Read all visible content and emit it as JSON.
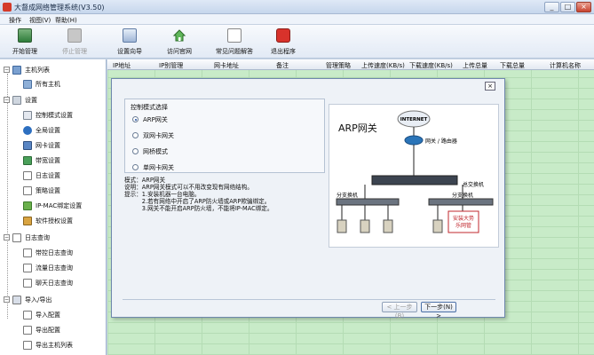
{
  "window": {
    "title": "大督成网络管理系统(V3.50)",
    "minimize": "_",
    "maximize": "□",
    "close": "×"
  },
  "menu": [
    "操作",
    "视图(V)",
    "帮助(H)"
  ],
  "toolbar": [
    {
      "label": "开始管理",
      "icon": "start-manage-icon",
      "disabled": false
    },
    {
      "label": "停止管理",
      "icon": "stop-manage-icon",
      "disabled": true
    },
    {
      "label": "设置向导",
      "icon": "wizard-icon",
      "disabled": false
    },
    {
      "label": "访问官网",
      "icon": "home-icon",
      "disabled": false
    },
    {
      "label": "常见问题解答",
      "icon": "faq-icon",
      "disabled": false
    },
    {
      "label": "退出程序",
      "icon": "power-icon",
      "disabled": false
    }
  ],
  "tree": {
    "groups": [
      {
        "label": "主机列表",
        "items": [
          "所有主机"
        ]
      },
      {
        "label": "设置",
        "items": [
          "控制模式设置",
          "全局设置",
          "网卡设置",
          "带宽设置",
          "日志设置",
          "策略设置",
          "IP-MAC绑定设置",
          "软件授权设置"
        ]
      },
      {
        "label": "日志查询",
        "items": [
          "带控日志查询",
          "流量日志查询",
          "聊天日志查询"
        ]
      },
      {
        "label": "导入/导出",
        "items": [
          "导入配置",
          "导出配置",
          "导出主机列表"
        ]
      }
    ]
  },
  "columns": [
    "IP地址",
    "IP别管理",
    "网卡地址",
    "备注",
    "管理策略",
    "上传速度(KB/s)",
    "下载速度(KB/s)",
    "上传总量",
    "下载总量",
    "计算机名称"
  ],
  "dialog": {
    "close": "×",
    "group_title": "控制模式选择",
    "options": [
      "ARP网关",
      "双网卡网关",
      "网桥模式",
      "单网卡网关"
    ],
    "selected": 0,
    "desc": [
      "模式：ARP网关",
      "说明：ARP网关模式可以不用改变现有网络结构。",
      "提示：1.安装机器一台电脑。",
      "　　　2.若有网络中开启了ARP防火墙或ARP欺骗绑定。",
      "　　　3.网关不能开启ARP防火墙，不能将IP-MAC绑定。"
    ],
    "diagram": {
      "title": "ARP网关",
      "internet": "INTERNET",
      "router": "网关 / 路由器",
      "core": "总交换机",
      "sw_left": "分支换机",
      "sw_right": "分支换机",
      "host": "安装大势\n乐网管"
    },
    "btn_prev": "< 上一步(B)",
    "btn_next": "下一步(N) >"
  }
}
